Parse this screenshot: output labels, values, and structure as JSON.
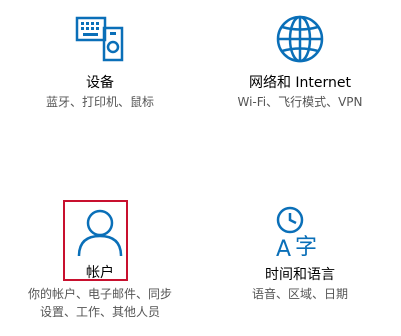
{
  "accent_color": "#0a6fb8",
  "highlight_color": "#c8102e",
  "tiles": [
    {
      "icon": "devices-icon",
      "title": "设备",
      "desc_lines": [
        "蓝牙、打印机、鼠标"
      ]
    },
    {
      "icon": "globe-icon",
      "title": "网络和 Internet",
      "desc_lines": [
        "Wi-Fi、飞行模式、VPN"
      ]
    },
    {
      "icon": "user-icon",
      "title": "帐户",
      "desc_lines": [
        "你的帐户、电子邮件、同步",
        "设置、工作、其他人员"
      ],
      "highlighted": true
    },
    {
      "icon": "time-language-icon",
      "title": "时间和语言",
      "desc_lines": [
        "语音、区域、日期"
      ]
    }
  ]
}
